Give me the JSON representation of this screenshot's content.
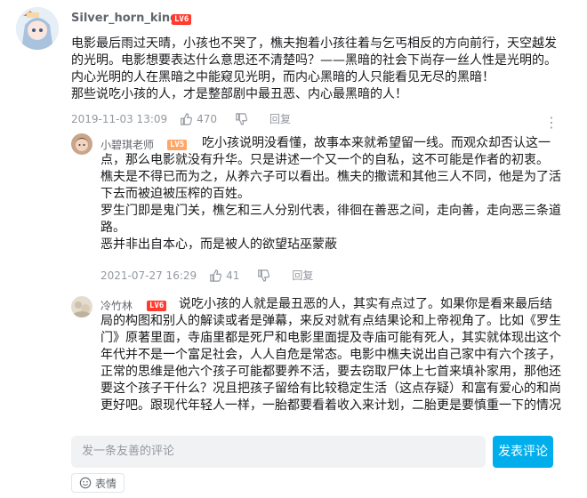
{
  "comment_main": {
    "username": "Silver_horn_king",
    "level": "LV6",
    "lines": [
      "电影最后雨过天晴，小孩也不哭了，樵夫抱着小孩往着与乞丐相反的方向前行，天空越发",
      "的光明。电影想要表达什么意思还不清楚吗？——黑暗的社会下尚存一丝人性是光明的。",
      "内心光明的人在黑暗之中能窥见光明，而内心黑暗的人只能看见无尽的黑暗！",
      "那些说吃小孩的人，才是整部剧中最丑恶、内心最黑暗的人！"
    ],
    "timestamp": "2019-11-03 13:09",
    "likes": "470",
    "reply_label": "回复"
  },
  "reply_1": {
    "username": "小碧琪老师",
    "level": "LV5",
    "lines": [
      "吃小孩说明没看懂，故事本来就希望留一线。而观众却否认这一",
      "点，那么电影就没有升华。只是讲述一个又一个的自私，这不可能是作者的初衷。",
      "樵夫是不得已而为之，从养六子可以看出。樵夫的撒谎和其他三人不同，他是为了活",
      "下去而被迫被压榨的百姓。",
      "罗生门即是鬼门关，樵乞和三人分别代表，徘徊在善恶之间，走向善，走向恶三条道",
      "路。",
      "恶并非出自本心，而是被人的欲望玷巫蒙蔽"
    ],
    "timestamp": "2021-07-27 16:29",
    "likes": "41",
    "reply_label": "回复"
  },
  "reply_2": {
    "username": "冷竹林",
    "level": "LV6",
    "lines": [
      "说吃小孩的人就是最丑恶的人，其实有点过了。如果你是看来最后结",
      "局的构图和别人的解读或者是弹幕，来反对就有点结果论和上帝视角了。比如《罗生",
      "门》原著里面，寺庙里都是死尸和电影里面提及寺庙可能有死人，其实就体现出这个",
      "年代并不是一个富足社会，人人自危是常态。电影中樵夫说出自己家中有六个孩子，",
      "正常的思维是他六个孩子可能都要养不活，要去窃取尸体上七首来填补家用，那他还",
      "要这个孩子干什么？况且把孩子留给有比较稳定生活（这点存疑）和富有爱心的和尚",
      "更好吧。跟现代年轻人一样，一胎都要看着收入来计划，二胎更是要慎重一下的情况"
    ]
  },
  "composer": {
    "placeholder": "发一条友善的评论",
    "send_label": "发表评论",
    "emoji_label": "表情"
  },
  "colors": {
    "accent": "#00aeec",
    "level6": "#ff3b30",
    "level5": "#ffa666"
  },
  "icons": {
    "like": "thumb-up-icon",
    "dislike": "thumb-down-icon",
    "more": "more-vertical-icon",
    "emoji": "smile-icon"
  }
}
